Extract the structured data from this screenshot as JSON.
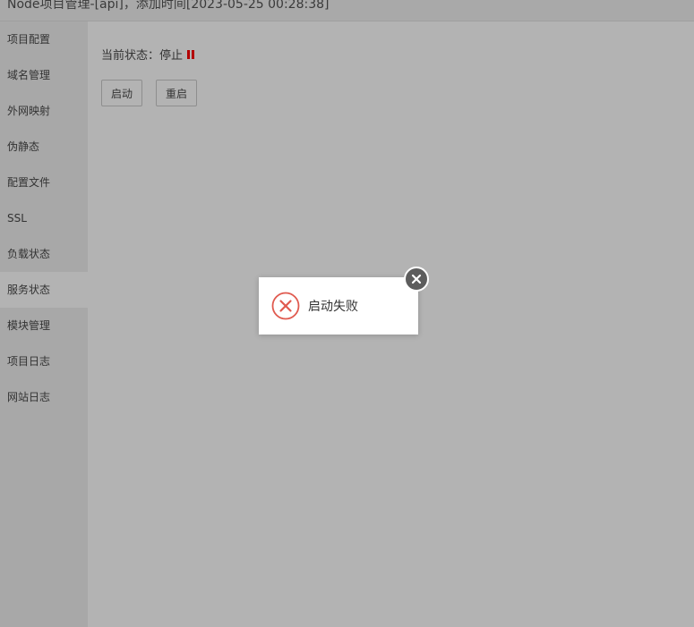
{
  "window": {
    "title": "Node项目管理-[api]，添加时间[2023-05-25 00:28:38]"
  },
  "sidebar": {
    "items": [
      {
        "label": "项目配置"
      },
      {
        "label": "域名管理"
      },
      {
        "label": "外网映射"
      },
      {
        "label": "伪静态"
      },
      {
        "label": "配置文件"
      },
      {
        "label": "SSL"
      },
      {
        "label": "负载状态"
      },
      {
        "label": "服务状态",
        "active": true
      },
      {
        "label": "模块管理"
      },
      {
        "label": "项目日志"
      },
      {
        "label": "网站日志"
      }
    ]
  },
  "main": {
    "status_label": "当前状态：停止",
    "status_icon": "pause-icon",
    "status_color": "#b30000",
    "buttons": {
      "start": "启动",
      "restart": "重启"
    }
  },
  "toast": {
    "icon": "error-circle-icon",
    "icon_color": "#e05a4f",
    "message": "启动失败",
    "close_icon": "close-icon"
  }
}
